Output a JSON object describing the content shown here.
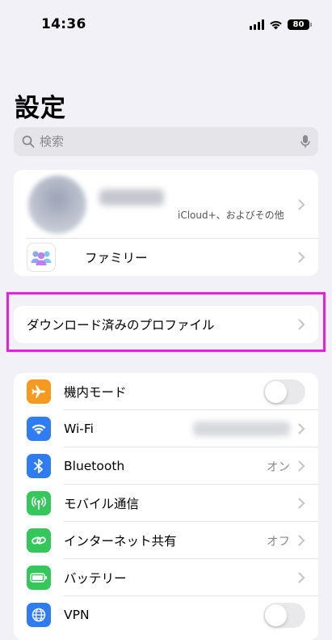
{
  "status_bar": {
    "time": "14:36",
    "battery": "80"
  },
  "page": {
    "title": "設定"
  },
  "search": {
    "placeholder": "検索"
  },
  "account": {
    "subtitle": "iCloud+、およびその他",
    "family_label": "ファミリー"
  },
  "profiles": {
    "label": "ダウンロード済みのプロファイル"
  },
  "settings": {
    "items": [
      {
        "label": "機内モード",
        "icon": "airplane-icon",
        "color": "#f7991c",
        "control": "toggle",
        "value": "off"
      },
      {
        "label": "Wi-Fi",
        "icon": "wifi-icon",
        "color": "#2e7cf6",
        "control": "chevron"
      },
      {
        "label": "Bluetooth",
        "icon": "bluetooth-icon",
        "color": "#2e7cf6",
        "control": "chevron",
        "detail": "オン"
      },
      {
        "label": "モバイル通信",
        "icon": "antenna-icon",
        "color": "#34c759",
        "control": "chevron"
      },
      {
        "label": "インターネット共有",
        "icon": "link-icon",
        "color": "#34c759",
        "control": "chevron",
        "detail": "オフ"
      },
      {
        "label": "バッテリー",
        "icon": "battery-icon",
        "color": "#34c759",
        "control": "chevron"
      },
      {
        "label": "VPN",
        "icon": "globe-icon",
        "color": "#2e7cf6",
        "control": "toggle",
        "value": "off"
      }
    ]
  },
  "colors": {
    "highlight": "#ee1ae6",
    "background": "#f2f1f7"
  }
}
